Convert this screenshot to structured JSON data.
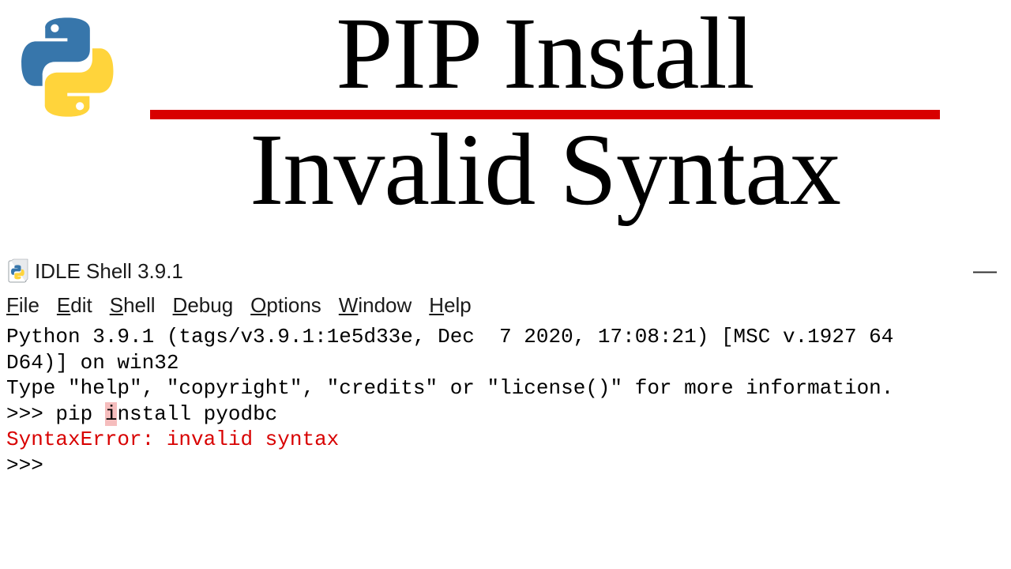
{
  "heading": {
    "top": "PIP Install",
    "bottom": "Invalid Syntax"
  },
  "window": {
    "title": "IDLE Shell 3.9.1",
    "minimize_glyph": "—"
  },
  "menu": {
    "file": {
      "accel": "F",
      "rest": "ile"
    },
    "edit": {
      "accel": "E",
      "rest": "dit"
    },
    "shell": {
      "accel": "S",
      "rest": "hell"
    },
    "debug": {
      "accel": "D",
      "rest": "ebug"
    },
    "options": {
      "accel": "O",
      "rest": "ptions"
    },
    "window": {
      "accel": "W",
      "rest": "indow"
    },
    "help": {
      "accel": "H",
      "rest": "elp"
    }
  },
  "shell": {
    "banner1": "Python 3.9.1 (tags/v3.9.1:1e5d33e, Dec  7 2020, 17:08:21) [MSC v.1927 64",
    "banner2": "D64)] on win32",
    "banner3": "Type \"help\", \"copyright\", \"credits\" or \"license()\" for more information.",
    "prompt": ">>> ",
    "cmd_pre": "pip ",
    "cmd_hl": "i",
    "cmd_post": "nstall pyodbc",
    "error": "SyntaxError: invalid syntax",
    "prompt2": ">>>"
  }
}
